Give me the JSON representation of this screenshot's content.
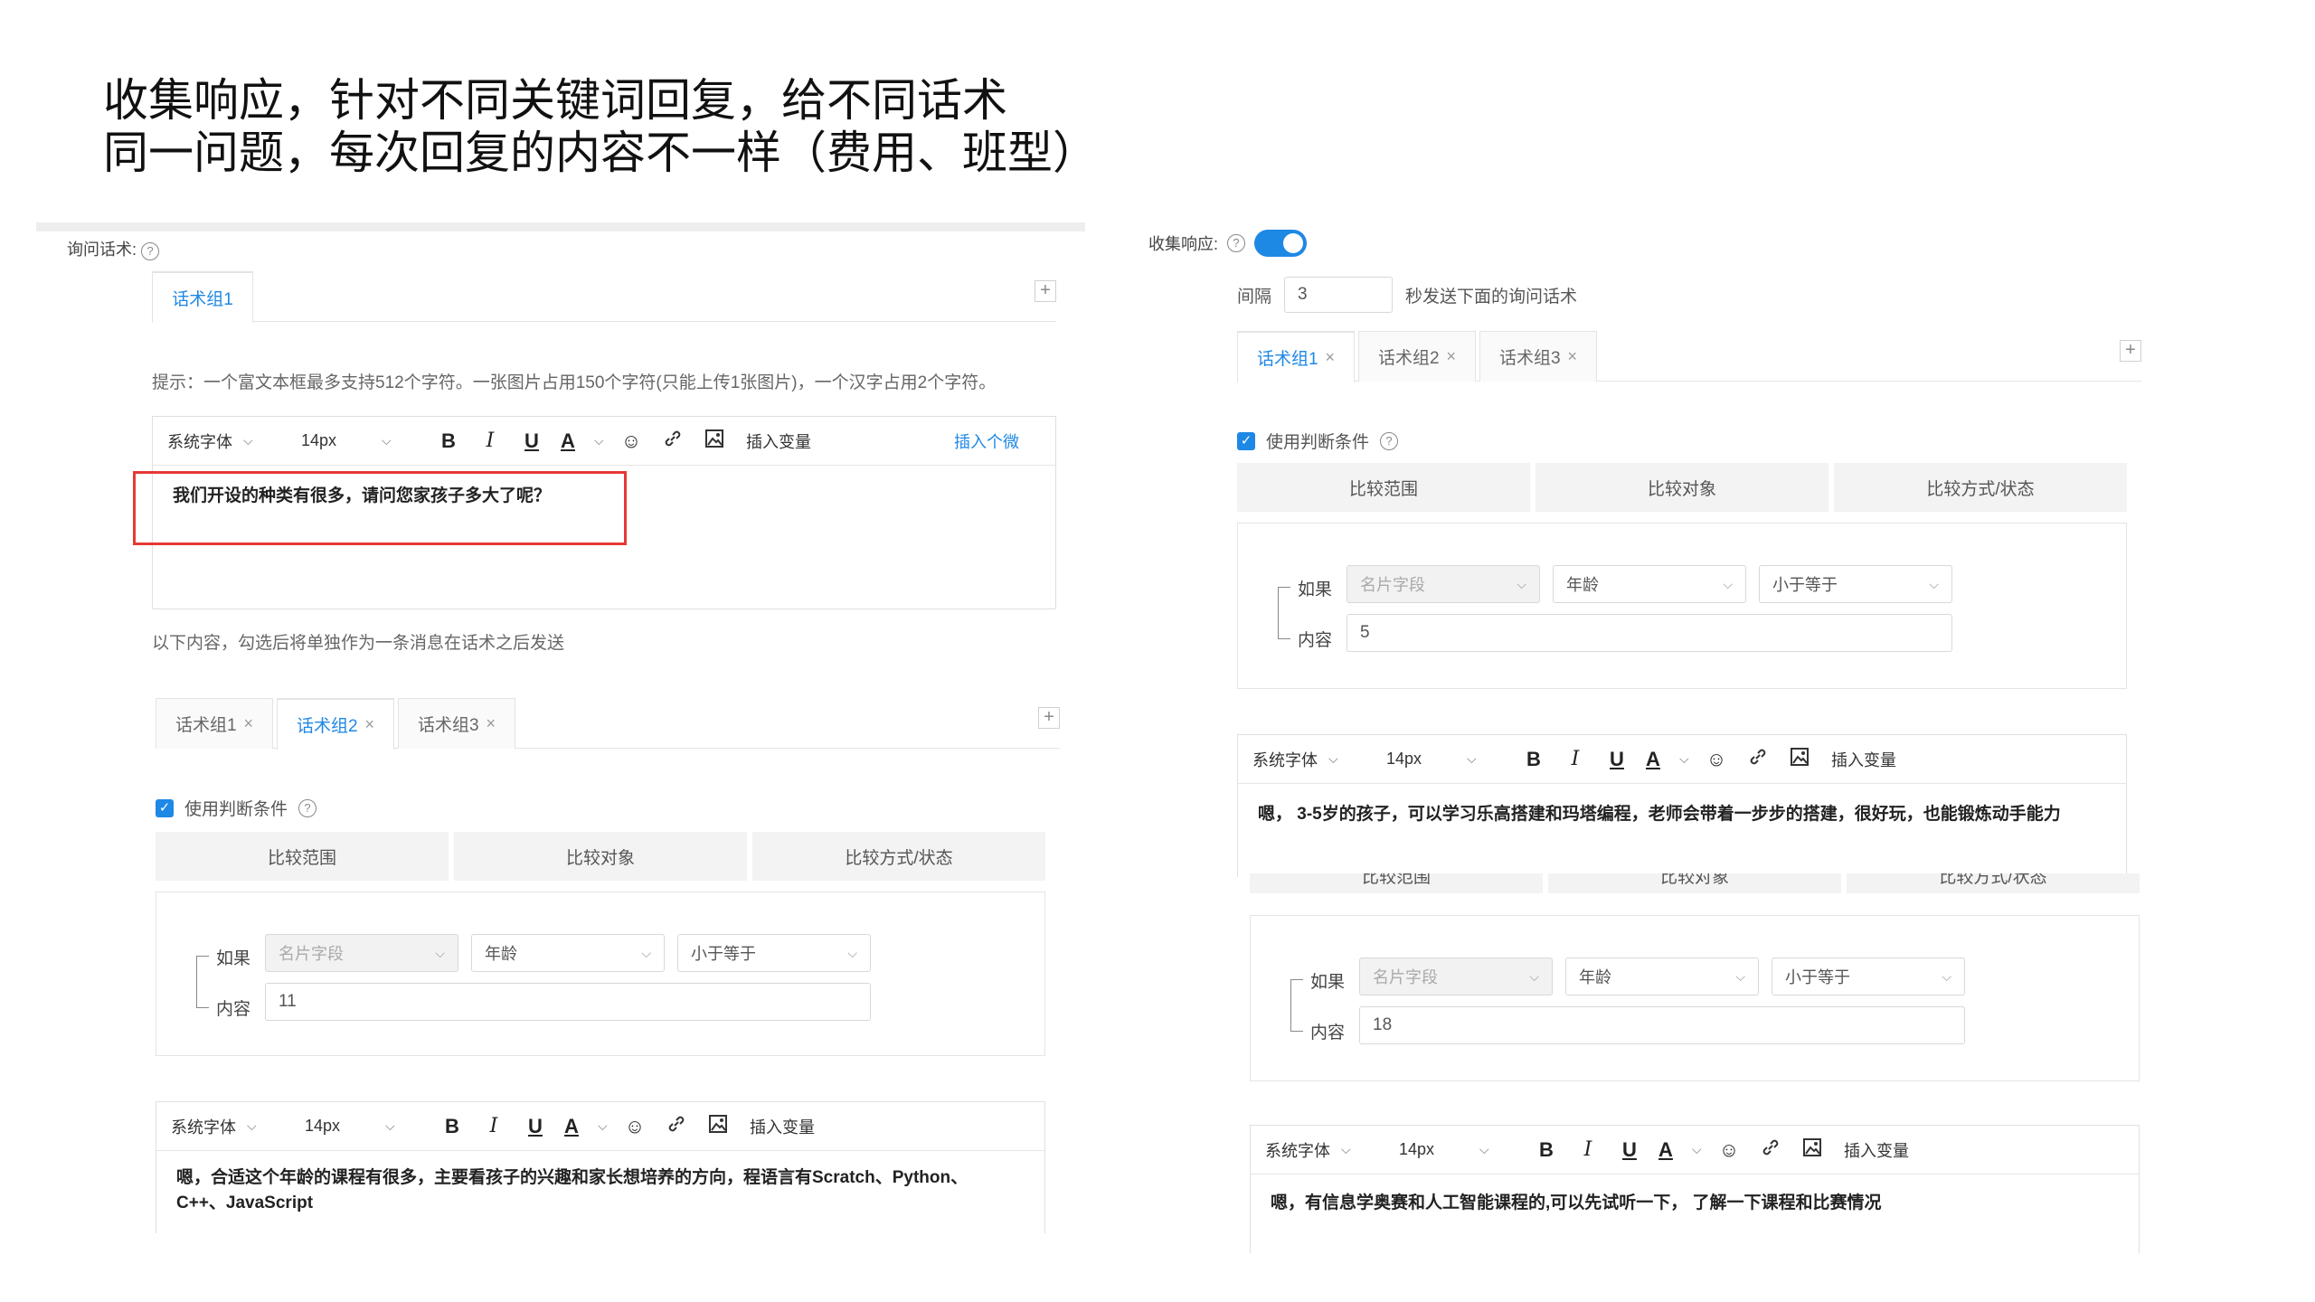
{
  "heading": {
    "line1": "收集响应，针对不同关键词回复，给不同话术",
    "line2": "同一问题，每次回复的内容不一样（费用、班型）"
  },
  "left": {
    "ask_label": "询问话术:",
    "help_icon": "?",
    "tab1": "话术组1",
    "plus": "+",
    "hint": "提示：一个富文本框最多支持512个字符。一张图片占用150个字符(只能上传1张图片)，一个汉字占用2个字符。",
    "toolbar": {
      "font": "系统字体",
      "size": "14px",
      "bold": "B",
      "italic": "I",
      "underline": "U",
      "color": "A",
      "insert_var": "插入变量",
      "insert_person": "插入个微"
    },
    "editor_text": "我们开设的种类有很多，请问您家孩子多大了呢？",
    "below_note": "以下内容，勾选后将单独作为一条消息在话术之后发送",
    "highlight_color": "#e53935"
  },
  "left_group2": {
    "tabs": [
      {
        "label": "话术组1",
        "close": "×"
      },
      {
        "label": "话术组2",
        "close": "×"
      },
      {
        "label": "话术组3",
        "close": "×"
      }
    ],
    "plus": "+",
    "use_condition": "使用判断条件",
    "help_icon": "?",
    "cmp_headers": [
      "比较范围",
      "比较对象",
      "比较方式/状态"
    ],
    "if_label": "如果",
    "content_label": "内容",
    "dd_field": "名片字段",
    "dd_object": "年龄",
    "dd_op": "小于等于",
    "content_value": "11",
    "toolbar": {
      "font": "系统字体",
      "size": "14px",
      "bold": "B",
      "italic": "I",
      "underline": "U",
      "color": "A",
      "insert_var": "插入变量"
    },
    "editor_text": "嗯，合适这个年龄的课程有很多，主要看孩子的兴趣和家长想培养的方向，程语言有Scratch、Python、C++、JavaScript"
  },
  "right": {
    "collect_label": "收集响应:",
    "help_icon": "?",
    "toggle_on": true,
    "interval_label": "间隔",
    "interval_value": "3",
    "interval_suffix": "秒发送下面的询问话术",
    "tabs": [
      {
        "label": "话术组1",
        "close": "×"
      },
      {
        "label": "话术组2",
        "close": "×"
      },
      {
        "label": "话术组3",
        "close": "×"
      }
    ],
    "plus": "+",
    "use_condition": "使用判断条件",
    "cmp_headers": [
      "比较范围",
      "比较对象",
      "比较方式/状态"
    ],
    "if_label": "如果",
    "content_label": "内容",
    "dd_field": "名片字段",
    "dd_object": "年龄",
    "dd_op": "小于等于",
    "content_value": "5",
    "toolbar": {
      "font": "系统字体",
      "size": "14px",
      "bold": "B",
      "italic": "I",
      "underline": "U",
      "color": "A",
      "insert_var": "插入变量"
    },
    "editor_text": "嗯，  3-5岁的孩子，可以学习乐高搭建和玛塔编程，老师会带着一步步的搭建，很好玩，也能锻炼动手能力",
    "accent_color": "#1e88e5"
  },
  "right_group3": {
    "cmp_headers": [
      "比较范围",
      "比较对象",
      "比较方式/状态"
    ],
    "if_label": "如果",
    "content_label": "内容",
    "dd_field": "名片字段",
    "dd_object": "年龄",
    "dd_op": "小于等于",
    "content_value": "18",
    "toolbar": {
      "font": "系统字体",
      "size": "14px",
      "bold": "B",
      "italic": "I",
      "underline": "U",
      "color": "A",
      "insert_var": "插入变量"
    },
    "editor_text": "嗯，有信息学奥赛和人工智能课程的,可以先试听一下，  了解一下课程和比赛情况"
  }
}
